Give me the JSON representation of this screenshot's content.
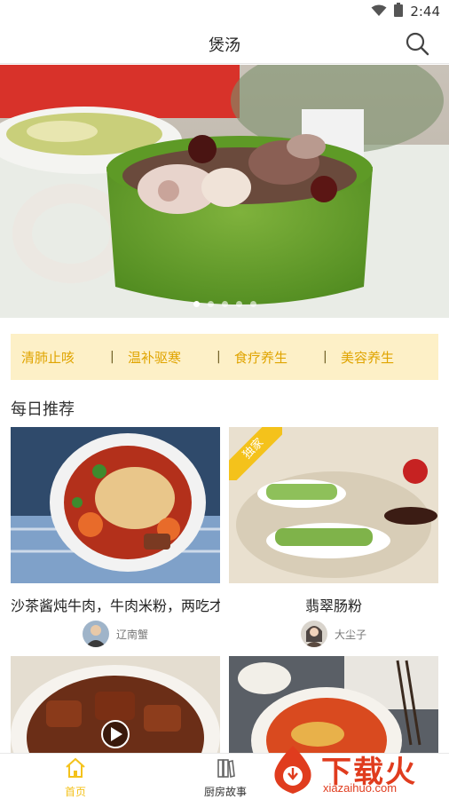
{
  "status_bar": {
    "time": "2:44"
  },
  "header": {
    "title": "煲汤"
  },
  "banner": {
    "slide_count": 5,
    "active_index": 0
  },
  "categories": [
    "清肺止咳",
    "温补驱寒",
    "食疗养生",
    "美容养生"
  ],
  "section": {
    "title": "每日推荐"
  },
  "recipes": [
    {
      "name": "沙茶酱炖牛肉，牛肉米粉，两吃才",
      "author": "辽南蟹",
      "exclusive": false,
      "video": false
    },
    {
      "name": "翡翠肠粉",
      "author": "大尘子",
      "exclusive": true,
      "badge": "独家",
      "video": false
    },
    {
      "name": "",
      "author": "",
      "exclusive": false,
      "video": true
    },
    {
      "name": "",
      "author": "",
      "exclusive": false,
      "video": false
    }
  ],
  "bottom_nav": [
    {
      "label": "首页",
      "active": true
    },
    {
      "label": "厨房故事",
      "active": false
    }
  ],
  "watermark": {
    "text": "下载火",
    "url": "xiazaihuo.com"
  },
  "colors": {
    "accent": "#f4c21b",
    "category_text": "#e0a400",
    "category_bg": "#fdf0c7",
    "watermark": "#e03c1e"
  }
}
